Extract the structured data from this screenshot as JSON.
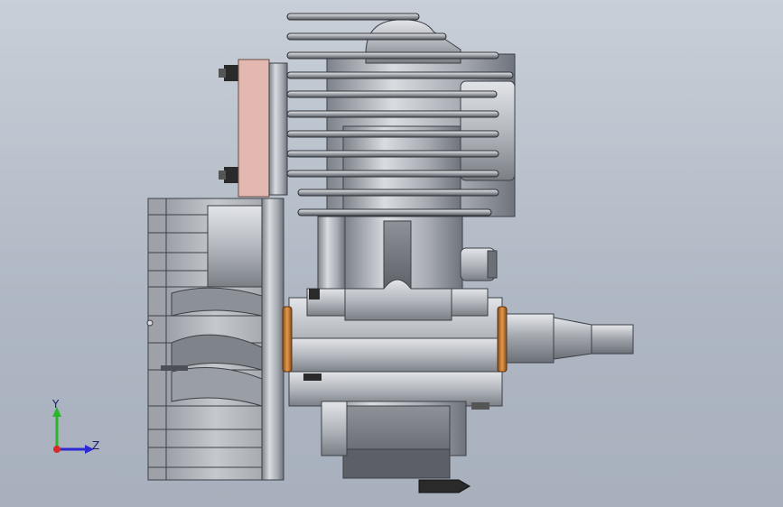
{
  "viewport": {
    "background_top": "#c8cfd8",
    "background_bottom": "#a7b0bc"
  },
  "model": {
    "kind": "engine-assembly",
    "colors": {
      "metal": "#b8bcc4",
      "metal_dark": "#6f747c",
      "metal_light": "#dde0e4",
      "carb_block": "#e2b8b0",
      "bearing_ring": "#c8782a",
      "plug": "#2a2a2a"
    }
  },
  "triad": {
    "y_label": "Y",
    "z_label": "Z",
    "y_color": "#2bb52b",
    "z_color": "#2b2bd6",
    "x_color": "#d62b2b"
  }
}
